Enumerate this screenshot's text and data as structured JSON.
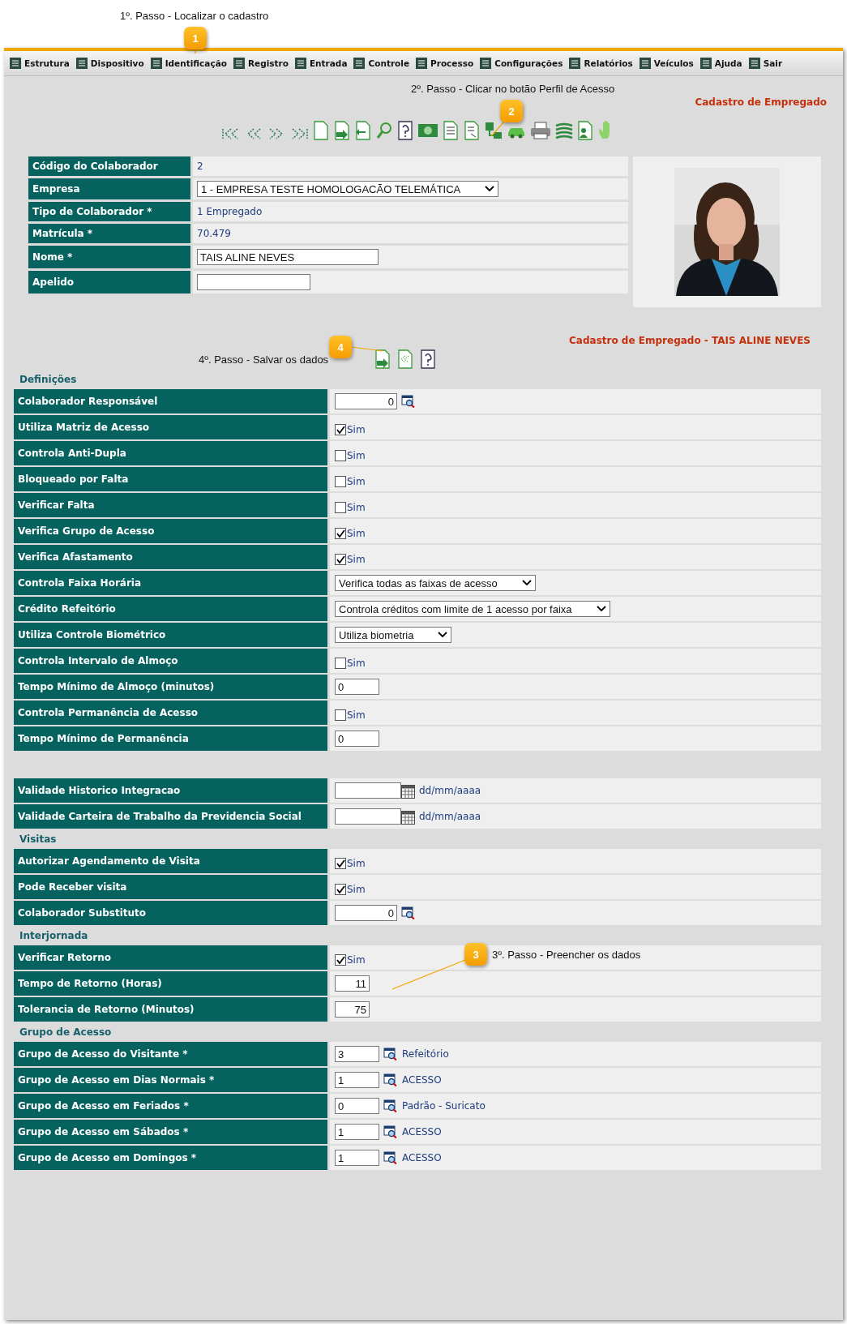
{
  "callouts": [
    {
      "badge": "1",
      "note": "1º. Passo - Localizar o cadastro"
    },
    {
      "badge": "2",
      "note": "2º. Passo - Clicar no botão Perfil de Acesso"
    },
    {
      "badge": "3",
      "note": "3º. Passo - Preencher os dados"
    },
    {
      "badge": "4",
      "note": "4º. Passo - Salvar os dados"
    }
  ],
  "menu": [
    {
      "label": "Estrutura"
    },
    {
      "label": "Dispositivo"
    },
    {
      "label": "Identificação"
    },
    {
      "label": "Registro"
    },
    {
      "label": "Entrada"
    },
    {
      "label": "Controle"
    },
    {
      "label": "Processo"
    },
    {
      "label": "Configurações"
    },
    {
      "label": "Relatórios"
    },
    {
      "label": "Veículos"
    },
    {
      "label": "Ajuda"
    },
    {
      "label": "Sair"
    }
  ],
  "page_title": "Cadastro de Empregado",
  "record": [
    {
      "label": "Código do Colaborador",
      "kind": "text",
      "value": "2"
    },
    {
      "label": "Empresa",
      "kind": "select",
      "value": "1 - EMPRESA TESTE HOMOLOGACÃO TELEMÁTICA"
    },
    {
      "label": "Tipo de Colaborador *",
      "kind": "text",
      "value": "1 Empregado"
    },
    {
      "label": "Matrícula *",
      "kind": "text",
      "value": "70.479"
    },
    {
      "label": "Nome *",
      "kind": "input",
      "value": "TAIS ALINE NEVES"
    },
    {
      "label": "Apelido",
      "kind": "input"
    }
  ],
  "record_title": "Cadastro de Empregado - TAIS ALINE NEVES",
  "sections": [
    {
      "title": "Definições",
      "rows": [
        {
          "label": "Colaborador Responsável",
          "kind": "lookup",
          "value": "0"
        },
        {
          "label": "Utiliza Matriz de Acesso",
          "kind": "checkbox",
          "checked": true,
          "option": "Sim"
        },
        {
          "label": "Controla Anti-Dupla",
          "kind": "checkbox",
          "checked": false,
          "option": "Sim"
        },
        {
          "label": "Bloqueado por Falta",
          "kind": "checkbox",
          "checked": false,
          "option": "Sim"
        },
        {
          "label": "Verificar Falta",
          "kind": "checkbox",
          "checked": false,
          "option": "Sim"
        },
        {
          "label": "Verifica Grupo de Acesso",
          "kind": "checkbox",
          "checked": true,
          "option": "Sim"
        },
        {
          "label": "Verifica Afastamento",
          "kind": "checkbox",
          "checked": true,
          "option": "Sim"
        },
        {
          "label": "Controla Faixa Horária",
          "kind": "select",
          "value": "Verifica todas as faixas de acesso"
        },
        {
          "label": "Crédito Refeitório",
          "kind": "select",
          "value": "Controla créditos com limite de 1 acesso por faixa"
        },
        {
          "label": "Utiliza Controle Biométrico",
          "kind": "select",
          "value": "Utiliza biometria"
        },
        {
          "label": "Controla Intervalo de Almoço",
          "kind": "checkbox",
          "checked": false,
          "option": "Sim"
        },
        {
          "label": "Tempo Mínimo de Almoço (minutos)",
          "kind": "input",
          "value": "0"
        },
        {
          "label": "Controla Permanência de Acesso",
          "kind": "checkbox",
          "checked": false,
          "option": "Sim"
        },
        {
          "label": "Tempo Mínimo de Permanência",
          "kind": "input",
          "value": "0"
        }
      ]
    },
    {
      "rows": [
        {
          "label": "Validade Historico Integracao",
          "kind": "date",
          "hint": "dd/mm/aaaa"
        },
        {
          "label": "Validade Carteira de Trabalho da Previdencia Social",
          "kind": "date",
          "hint": "dd/mm/aaaa"
        }
      ]
    },
    {
      "title": "Visitas",
      "rows": [
        {
          "label": "Autorizar Agendamento de Visita",
          "kind": "checkbox",
          "checked": true,
          "option": "Sim"
        },
        {
          "label": "Pode Receber visita",
          "kind": "checkbox",
          "checked": true,
          "option": "Sim"
        },
        {
          "label": "Colaborador Substituto",
          "kind": "lookup",
          "value": "0"
        }
      ]
    },
    {
      "title": "Interjornada",
      "rows": [
        {
          "label": "Verificar Retorno",
          "kind": "checkbox",
          "checked": true,
          "option": "Sim"
        },
        {
          "label": "Tempo de Retorno (Horas)",
          "kind": "number",
          "value": "11"
        },
        {
          "label": "Tolerancia de Retorno (Minutos)",
          "kind": "number",
          "value": "75"
        }
      ]
    },
    {
      "title": "Grupo de Acesso",
      "rows": [
        {
          "label": "Grupo de Acesso do Visitante *",
          "kind": "group",
          "value": "3",
          "link": "Refeitório"
        },
        {
          "label": "Grupo de Acesso em Dias Normais *",
          "kind": "group",
          "value": "1",
          "link": "ACESSO"
        },
        {
          "label": "Grupo de Acesso em Feriados *",
          "kind": "group",
          "value": "0",
          "link": "Padrão - Suricato"
        },
        {
          "label": "Grupo de Acesso em Sábados *",
          "kind": "group",
          "value": "1",
          "link": "ACESSO"
        },
        {
          "label": "Grupo de Acesso em Domingos *",
          "kind": "group",
          "value": "1",
          "link": "ACESSO"
        }
      ]
    }
  ]
}
